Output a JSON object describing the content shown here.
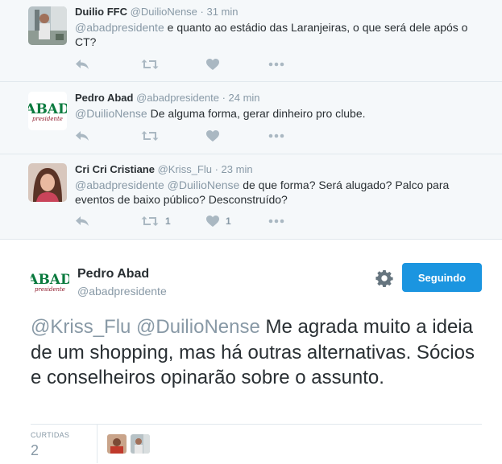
{
  "replies": [
    {
      "name": "Duilio FFC",
      "handle": "@DuilioNense",
      "time": "· 31 min",
      "mention": "@abadpresidente",
      "text_line1": " e quanto  ao estádio das Laranjeiras, o que será dele após o",
      "text_line2": "CT?",
      "retweets": "",
      "likes": ""
    },
    {
      "name": "Pedro Abad",
      "handle": "@abadpresidente",
      "time": "· 24 min",
      "mention": "@DuilioNense",
      "text_line1": " De alguma forma, gerar dinheiro pro clube.",
      "text_line2": "",
      "retweets": "",
      "likes": ""
    },
    {
      "name": "Cri Cri Cristiane",
      "handle": "@Kriss_Flu",
      "time": "· 23 min",
      "mention": "@abadpresidente @DuilioNense",
      "text_line1": " de que forma? Será alugado? Palco para",
      "text_line2": "eventos de baixo público? Desconstruído?",
      "retweets": "1",
      "likes": "1"
    }
  ],
  "main_tweet": {
    "name": "Pedro Abad",
    "handle": "@abadpresidente",
    "follow_label": "Seguindo",
    "mention": "@Kriss_Flu @DuilioNense",
    "text": " Me agrada muito a ideia de um shopping, mas há outras alternativas. Sócios e conselheiros opinarão sobre o assunto.",
    "likes_label": "CURTIDAS",
    "likes_count": "2"
  },
  "logo": {
    "top": "ABAD",
    "script": "presidente"
  },
  "icons": [
    "reply-icon",
    "retweet-icon",
    "heart-icon",
    "more-icon",
    "gear-icon"
  ],
  "colors": {
    "accent": "#1b95e0",
    "muted": "#8899a6",
    "icon": "#aab8c2",
    "logo_green": "#0a7a3e",
    "logo_red": "#8e1b2c"
  }
}
